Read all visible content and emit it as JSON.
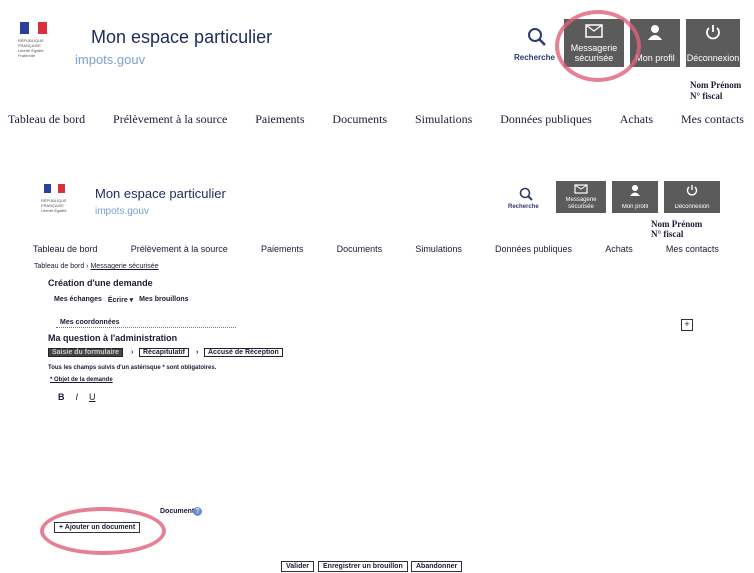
{
  "top": {
    "title": "Mon espace particulier",
    "subtitle": "impots.gouv",
    "search_label": "Recherche",
    "buttons": [
      {
        "label": "Messagerie sécurisée",
        "icon": "mail-icon"
      },
      {
        "label": "Mon profil",
        "icon": "user-icon"
      },
      {
        "label": "Déconnexion",
        "icon": "power-icon"
      }
    ],
    "user_name": "Nom Prénom",
    "fiscal_number": "N° fiscal",
    "nav": [
      "Tableau de bord",
      "Prélèvement à la source",
      "Paiements",
      "Documents",
      "Simulations",
      "Données publiques",
      "Achats",
      "Mes contacts"
    ]
  },
  "page": {
    "title": "Mon espace particulier",
    "subtitle": "impots.gouv",
    "search_label": "Recherche",
    "buttons": [
      {
        "label": "Messagerie sécurisée",
        "icon": "mail-icon"
      },
      {
        "label": "Mon profil",
        "icon": "user-icon"
      },
      {
        "label": "Déconnexion",
        "icon": "power-icon"
      }
    ],
    "user_name": "Nom Prénom",
    "fiscal_number": "N° fiscal",
    "nav": [
      "Tableau de bord",
      "Prélèvement à la source",
      "Paiements",
      "Documents",
      "Simulations",
      "Données publiques",
      "Achats",
      "Mes contacts"
    ],
    "breadcrumb": {
      "home": "Tableau de bord",
      "sep": "›",
      "current": "Messagerie sécurisée"
    },
    "heading": "Création d'une demande",
    "tabs": {
      "exchanges": "Mes échanges",
      "write": "Écrire ▾",
      "drafts": "Mes brouillons"
    },
    "coords_title": "Mes coordonnées",
    "question_title": "Ma question à l'administration",
    "steps": [
      "Saisie du formulaire",
      "Récapitulatif",
      "Accusé de Réception"
    ],
    "step_sep": "›",
    "required_note": "Tous les champs suivis d'un astérisque * sont obligatoires.",
    "object_label": "* Objet de la demande",
    "format": {
      "bold": "B",
      "italic": "I",
      "underline": "U"
    },
    "attach_label": "Documents",
    "add_doc": "+ Ajouter un document",
    "actions": {
      "validate": "Valider",
      "save_draft": "Enregistrer un brouillon",
      "abandon": "Abandonner"
    }
  },
  "colors": {
    "accent": "#1e2a5e",
    "buttons": "#5b5b5b",
    "highlight": "#e0607a",
    "link": "#7aa0cf"
  }
}
